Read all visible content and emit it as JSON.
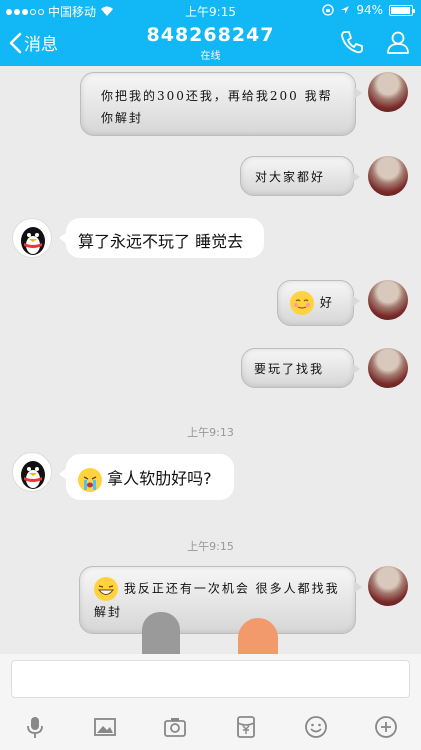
{
  "status": {
    "carrier": "中国移动",
    "time": "上午9:15",
    "battery_percent": "94%",
    "battery_level": 0.94
  },
  "header": {
    "back_label": "消息",
    "title": "848268247",
    "subtitle": "在线"
  },
  "messages": [
    {
      "side": "out",
      "text": "你把我的300还我，再给我200 我帮你解封"
    },
    {
      "side": "out",
      "text": "对大家都好"
    },
    {
      "side": "in",
      "text": "算了永远不玩了 睡觉去"
    },
    {
      "side": "out",
      "text": "好",
      "emoji": "smile-emoji"
    },
    {
      "side": "out",
      "text": "要玩了找我"
    },
    {
      "side": "in",
      "text": "拿人软肋好吗?",
      "emoji": "crying-emoji"
    },
    {
      "side": "out",
      "text": "我反正还有一次机会 很多人都找我解封",
      "emoji": "grin-emoji"
    }
  ],
  "timestamps": [
    "上午9:13",
    "上午9:15"
  ],
  "colors": {
    "header": "#12b7f5",
    "background": "#ebebeb"
  },
  "toolbar": [
    "mic-icon",
    "image-icon",
    "camera-icon",
    "red-packet-icon",
    "emoji-icon",
    "plus-icon"
  ]
}
